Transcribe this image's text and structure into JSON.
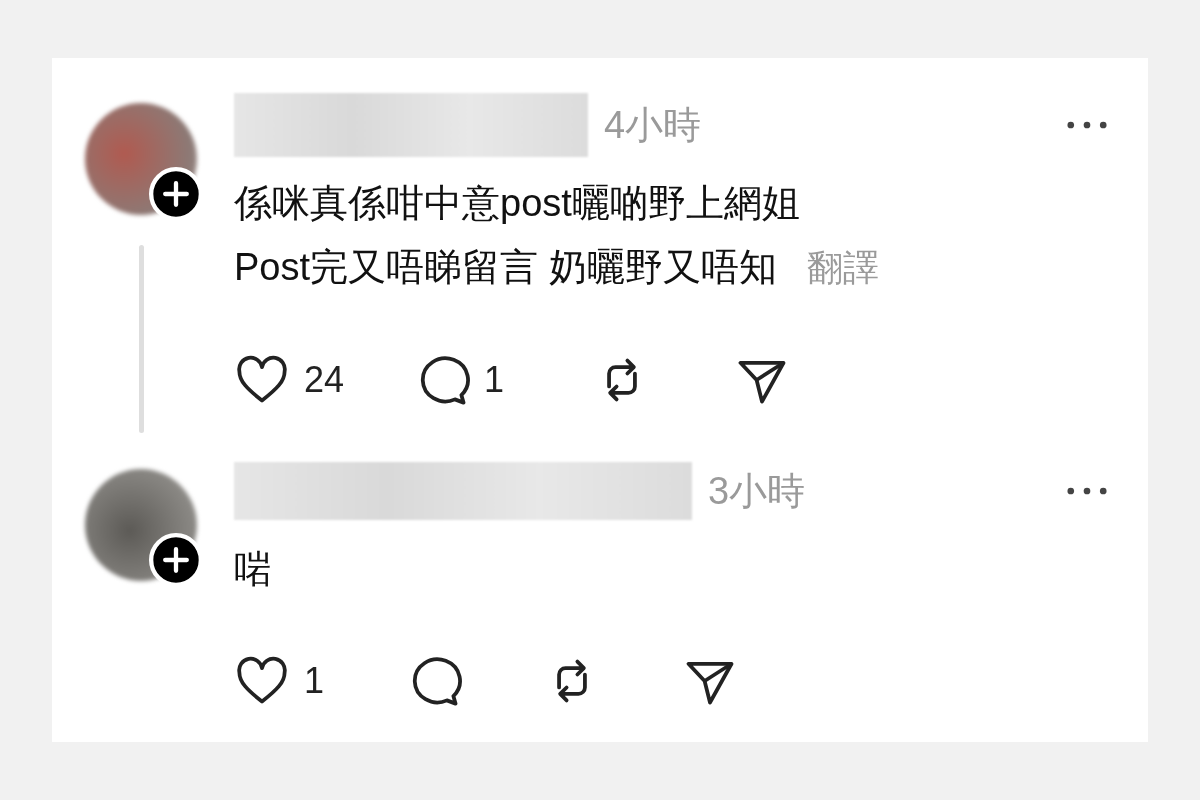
{
  "posts": [
    {
      "time": "4小時",
      "lines": [
        "係咪真係咁中意post曬啲野上網姐",
        "Post完又唔睇留言 奶曬野又唔知"
      ],
      "translate": "翻譯",
      "likes": "24",
      "replies": "1",
      "thread_line": true
    },
    {
      "time": "3小時",
      "lines": [
        "啱"
      ],
      "likes": "1",
      "thread_line": false
    }
  ]
}
